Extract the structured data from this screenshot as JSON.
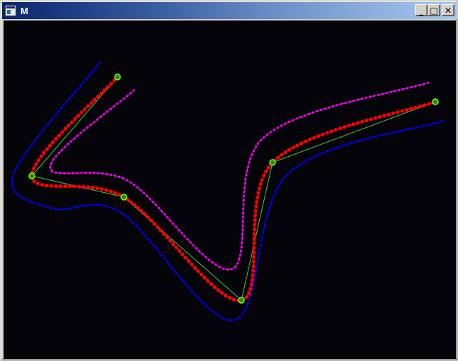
{
  "window": {
    "title": "M",
    "buttons": {
      "minimize_glyph": "_",
      "maximize_glyph": "□",
      "close_glyph": "✕"
    }
  },
  "colors": {
    "canvas_bg": "#050408",
    "control_line": "#3cd23c",
    "control_point_fill": "#228b22",
    "control_point_ring": "#7cfc00",
    "center_curve": "#ff0000",
    "offset_inner": "#ff00ff",
    "offset_outer": "#0000ff"
  },
  "curves": {
    "control_points": [
      [
        165,
        108
      ],
      [
        44,
        248
      ],
      [
        174,
        278
      ],
      [
        340,
        424
      ],
      [
        384,
        229
      ],
      [
        614,
        143
      ]
    ],
    "center": [
      [
        165,
        108
      ],
      [
        44,
        248
      ],
      [
        174,
        278
      ],
      [
        340,
        424
      ],
      [
        384,
        229
      ],
      [
        614,
        143
      ]
    ],
    "outer": [
      [
        140,
        88
      ],
      [
        18,
        246
      ],
      [
        72,
        294
      ],
      [
        170,
        300
      ],
      [
        330,
        452
      ],
      [
        406,
        245
      ],
      [
        626,
        170
      ]
    ],
    "inner": [
      [
        188,
        127
      ],
      [
        70,
        235
      ],
      [
        180,
        255
      ],
      [
        326,
        380
      ],
      [
        370,
        195
      ],
      [
        604,
        116
      ]
    ]
  }
}
